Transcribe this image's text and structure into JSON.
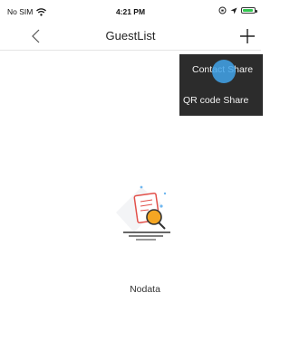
{
  "status_bar": {
    "carrier": "No SIM",
    "time": "4:21 PM",
    "battery_level": 0.9,
    "battery_color": "#31c74f"
  },
  "nav": {
    "title": "GuestList",
    "back_icon": "chevron-left-icon",
    "add_icon": "plus-icon"
  },
  "share_menu": {
    "items": [
      {
        "label": "Contact Share"
      },
      {
        "label": "QR code Share"
      }
    ],
    "background": "#2c2c2c"
  },
  "empty_state": {
    "icon": "document-search-icon",
    "message": "Nodata",
    "accent_color": "#f5a623"
  }
}
